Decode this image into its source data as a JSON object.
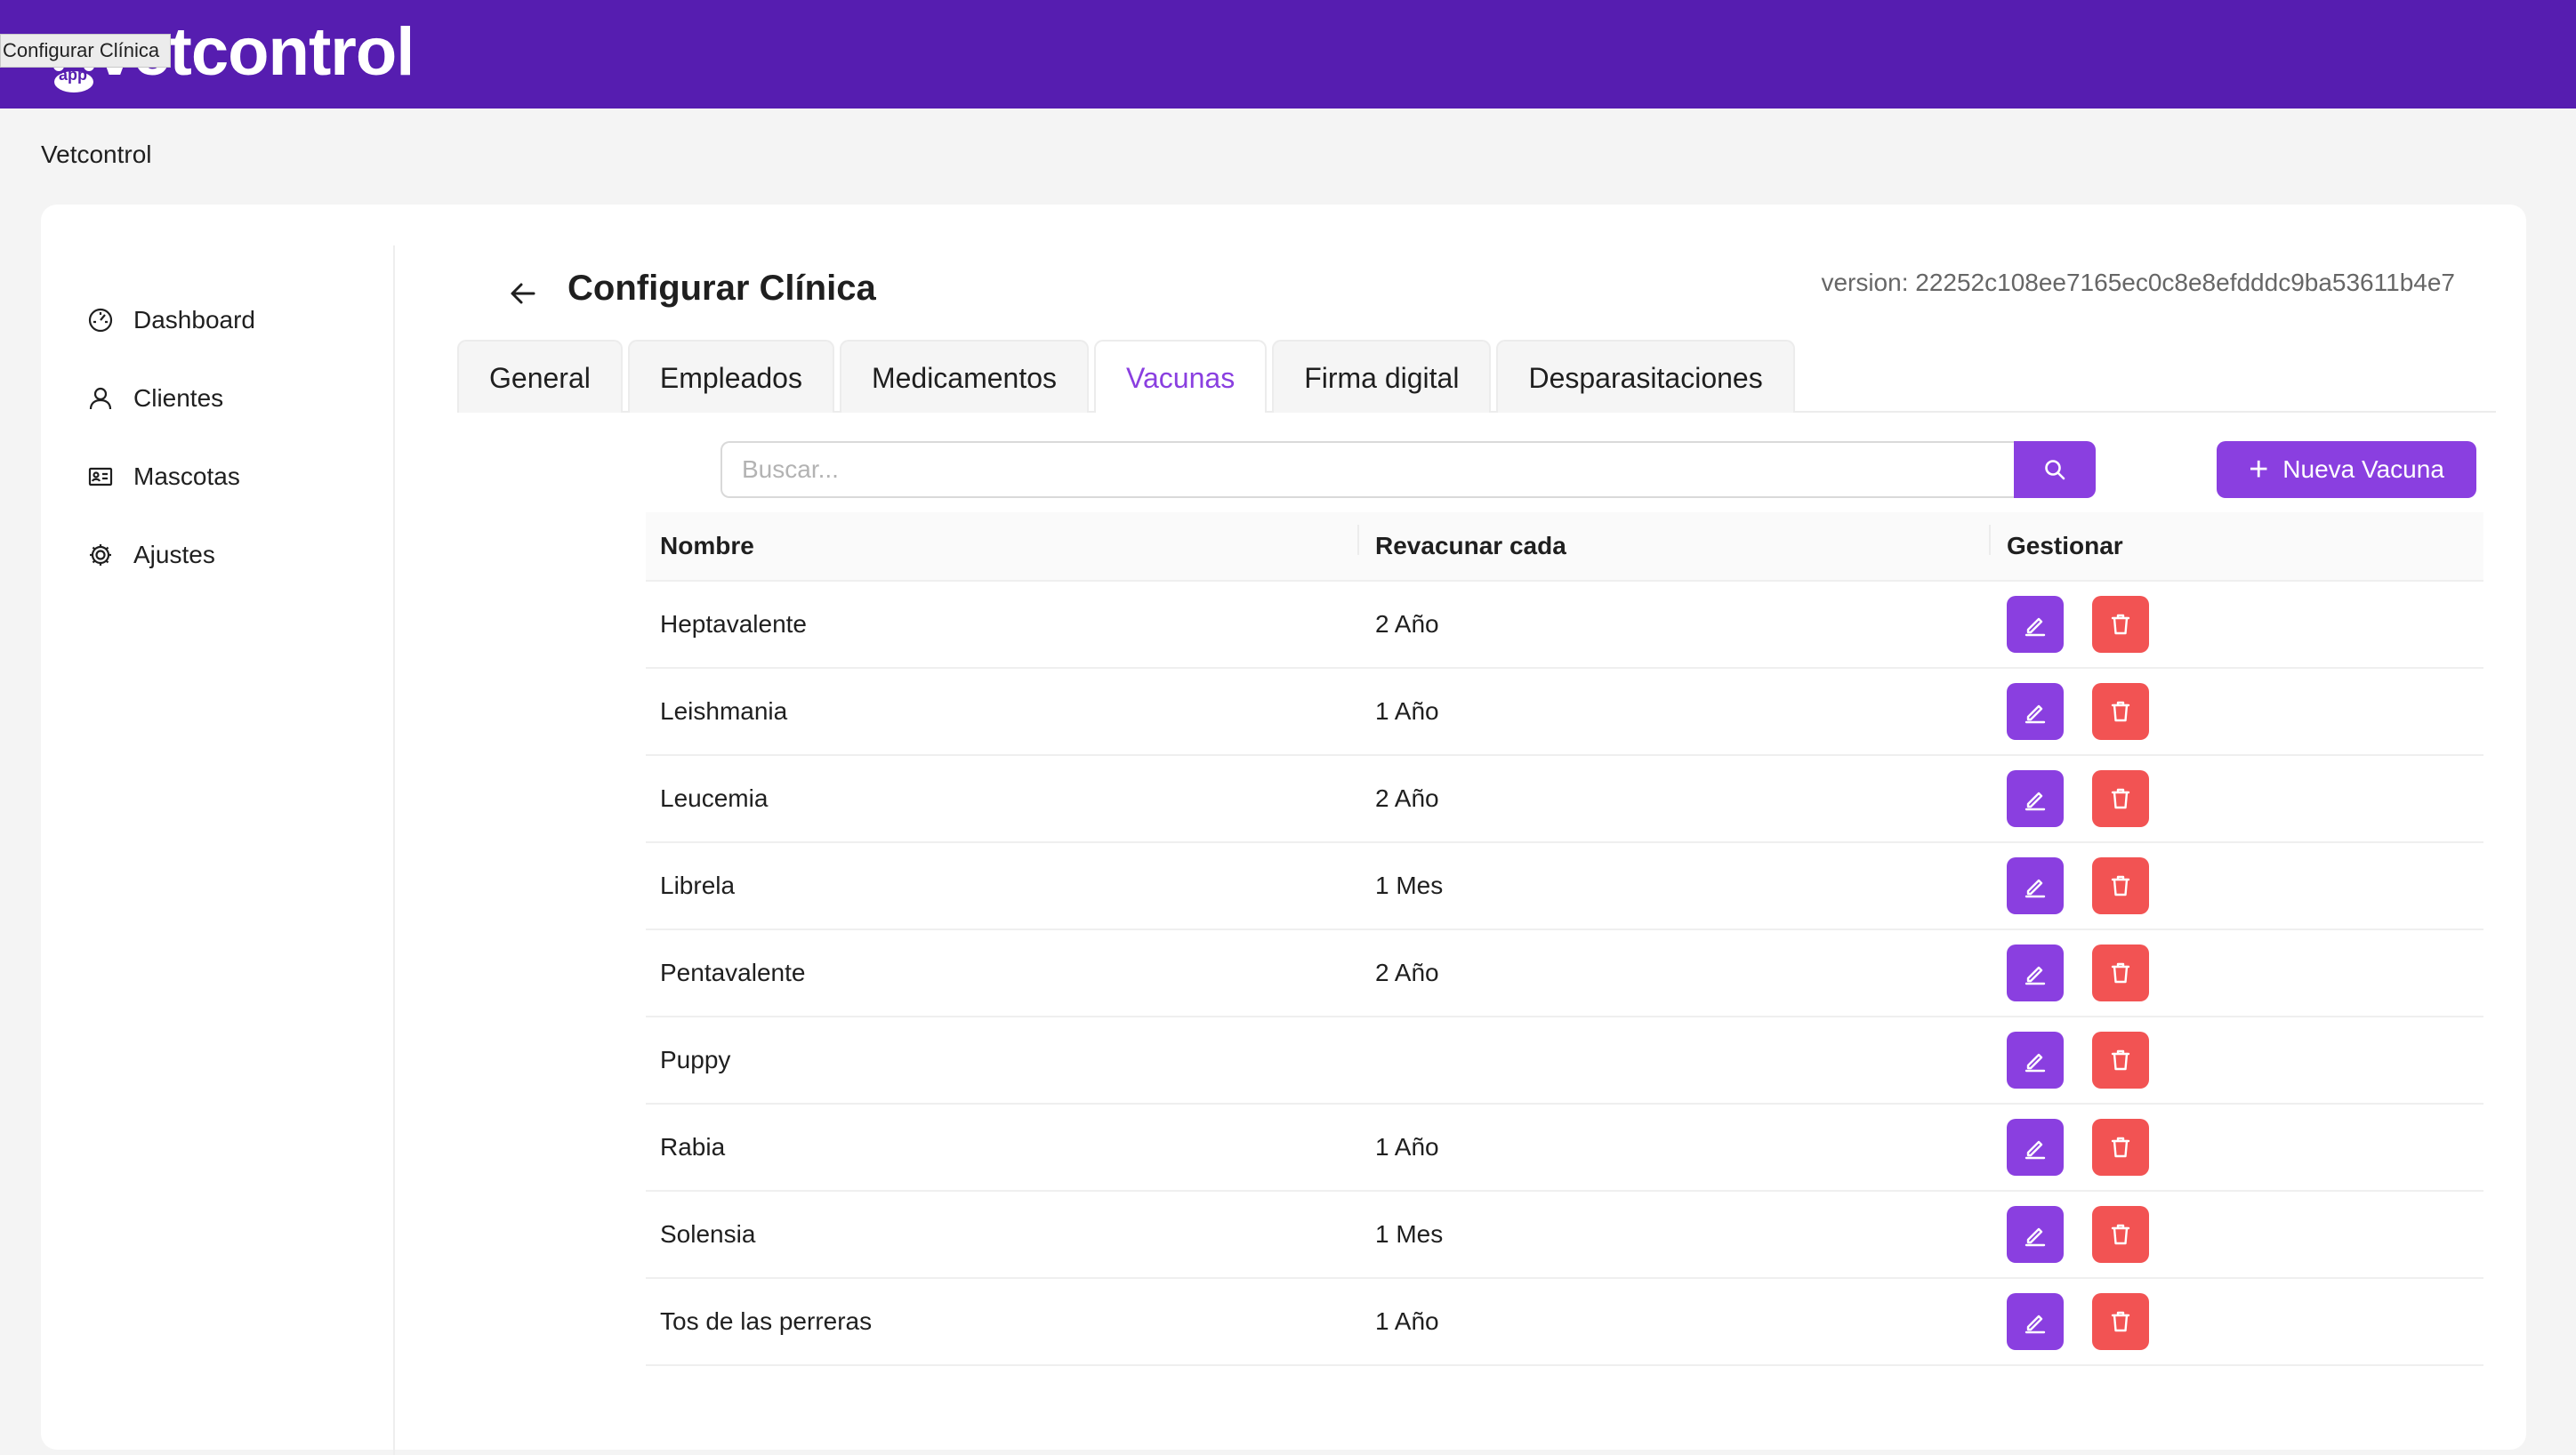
{
  "header": {
    "logo_text": "vetcontrol",
    "logo_app": "app",
    "tooltip": "Configurar Clínica",
    "brand_color": "#561db0"
  },
  "breadcrumb": "Vetcontrol",
  "sidebar": {
    "items": [
      {
        "label": "Dashboard",
        "icon": "dashboard-gauge-icon"
      },
      {
        "label": "Clientes",
        "icon": "user-icon"
      },
      {
        "label": "Mascotas",
        "icon": "id-card-icon"
      },
      {
        "label": "Ajustes",
        "icon": "gear-icon"
      }
    ]
  },
  "page": {
    "title": "Configurar Clínica",
    "version": "version: 22252c108ee7165ec0c8e8efdddc9ba53611b4e7"
  },
  "tabs": [
    {
      "label": "General",
      "active": false
    },
    {
      "label": "Empleados",
      "active": false
    },
    {
      "label": "Medicamentos",
      "active": false
    },
    {
      "label": "Vacunas",
      "active": true
    },
    {
      "label": "Firma digital",
      "active": false
    },
    {
      "label": "Desparasitaciones",
      "active": false
    }
  ],
  "search": {
    "placeholder": "Buscar...",
    "value": ""
  },
  "new_button": "Nueva Vacuna",
  "table": {
    "headers": [
      "Nombre",
      "Revacunar cada",
      "Gestionar"
    ],
    "rows": [
      {
        "name": "Heptavalente",
        "revaccinate": "2 Año"
      },
      {
        "name": "Leishmania",
        "revaccinate": "1 Año"
      },
      {
        "name": "Leucemia",
        "revaccinate": "2 Año"
      },
      {
        "name": "Librela",
        "revaccinate": "1 Mes"
      },
      {
        "name": "Pentavalente",
        "revaccinate": "2 Año"
      },
      {
        "name": "Puppy",
        "revaccinate": ""
      },
      {
        "name": "Rabia",
        "revaccinate": "1 Año"
      },
      {
        "name": "Solensia",
        "revaccinate": "1 Mes"
      },
      {
        "name": "Tos de las perreras",
        "revaccinate": "1 Año"
      }
    ]
  },
  "colors": {
    "accent": "#8a3fe0",
    "danger": "#f25353"
  }
}
